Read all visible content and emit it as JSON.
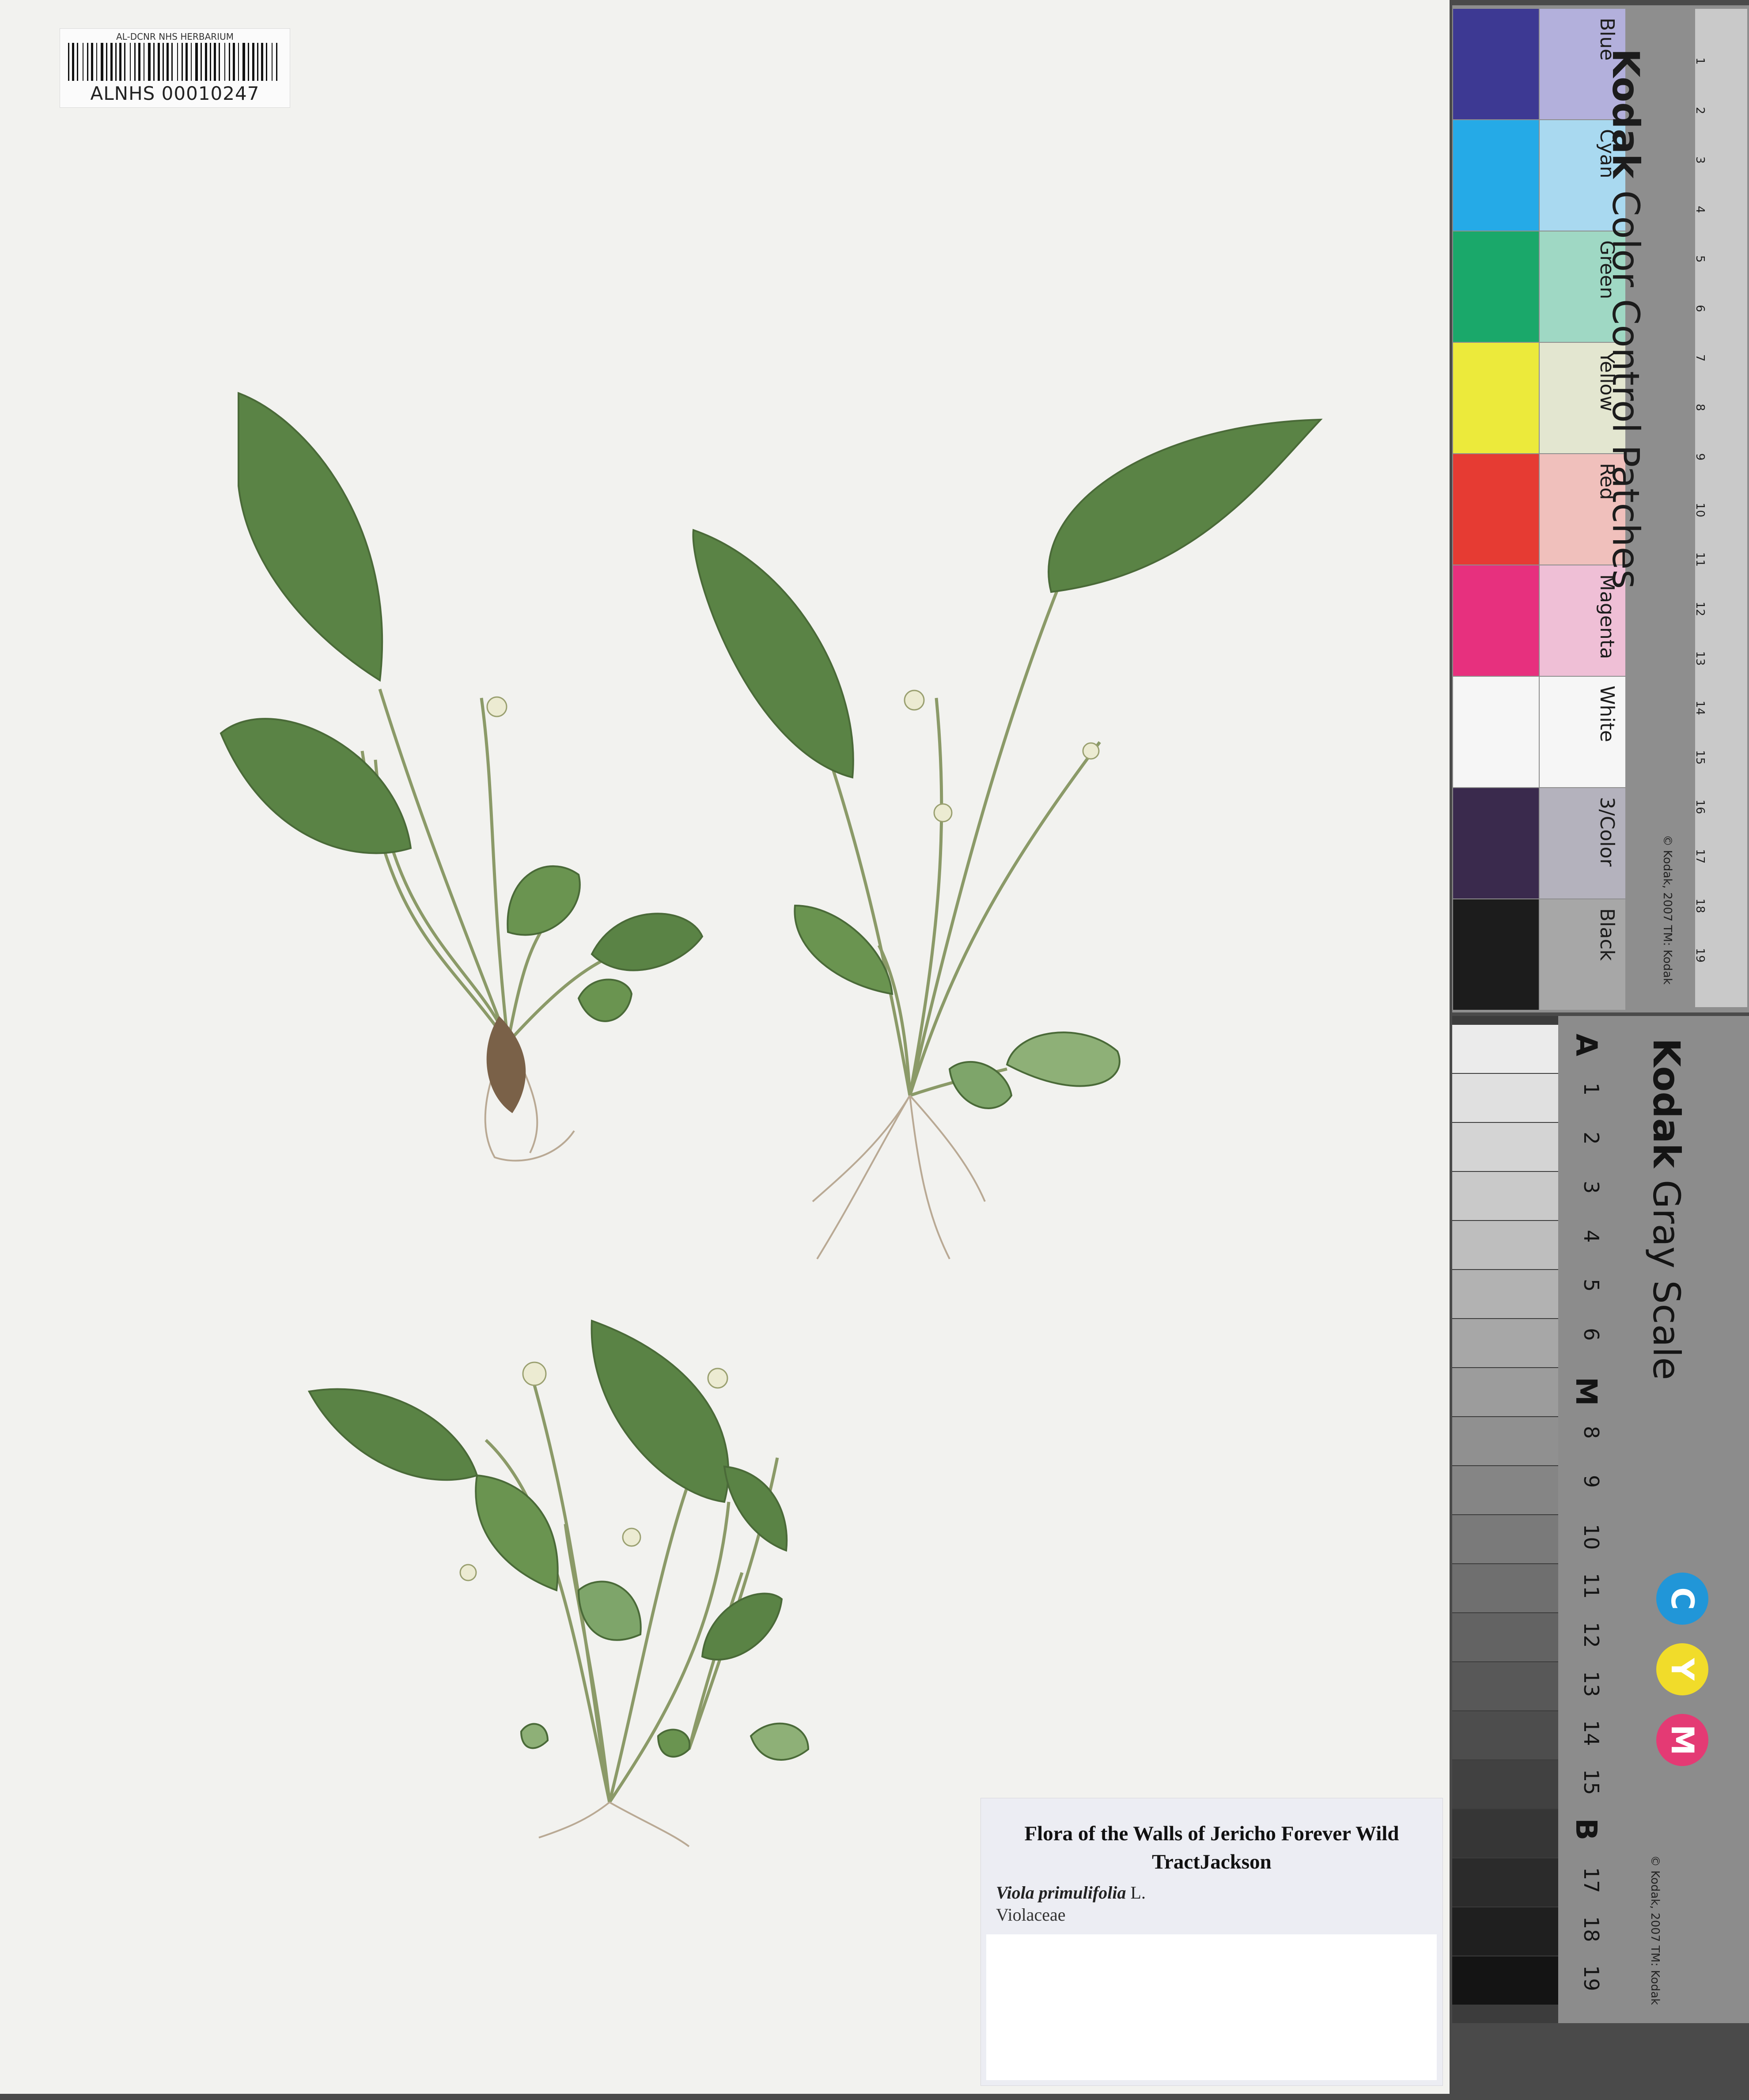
{
  "barcode": {
    "herbarium": "AL-DCNR NHS HERBARIUM",
    "number": "ALNHS 00010247"
  },
  "label": {
    "title": "Flora of the Walls of Jericho Forever Wild TractJackson",
    "species": "Viola primulifolia",
    "author": "L.",
    "family": "Violaceae"
  },
  "color_card": {
    "brand": "Kodak",
    "title": "Color Control Patches",
    "patches": [
      {
        "label": "Blue",
        "dark": "#3d3993",
        "light": "#b3b0dc"
      },
      {
        "label": "Cyan",
        "dark": "#25aae7",
        "light": "#a9d9f0"
      },
      {
        "label": "Green",
        "dark": "#1aa86a",
        "light": "#9fd8c4"
      },
      {
        "label": "Yellow",
        "dark": "#ecea3b",
        "light": "#e3e6d0"
      },
      {
        "label": "Red",
        "dark": "#e63b33",
        "light": "#f0c0bc"
      },
      {
        "label": "Magenta",
        "dark": "#e7307e",
        "light": "#efbfd6"
      },
      {
        "label": "White",
        "dark": "#f6f6f6",
        "light": "#f6f6f6"
      },
      {
        "label": "3/Color",
        "dark": "#3a2a4d",
        "light": "#b4b2bd"
      },
      {
        "label": "Black",
        "dark": "#1c1c1c",
        "light": "#a7a7a7"
      }
    ],
    "copyright": "© Kodak, 2007 TM: Kodak",
    "ruler_units": [
      "cm",
      "inches"
    ],
    "ruler_cm": [
      "1",
      "2",
      "3",
      "4",
      "5",
      "6",
      "7",
      "8",
      "9",
      "10",
      "11",
      "12",
      "13",
      "14",
      "15",
      "16",
      "17",
      "18",
      "19"
    ]
  },
  "gray_card": {
    "brand": "Kodak",
    "title": "Gray Scale",
    "steps": [
      "A",
      "1",
      "2",
      "3",
      "4",
      "5",
      "6",
      "M",
      "8",
      "9",
      "10",
      "11",
      "12",
      "13",
      "14",
      "15",
      "B",
      "17",
      "18",
      "19"
    ],
    "dots": [
      {
        "letter": "C",
        "color": "#2196d8"
      },
      {
        "letter": "Y",
        "color": "#f1dc2a"
      },
      {
        "letter": "M",
        "color": "#e43a74"
      }
    ],
    "copyright": "© Kodak, 2007 TM: Kodak"
  }
}
